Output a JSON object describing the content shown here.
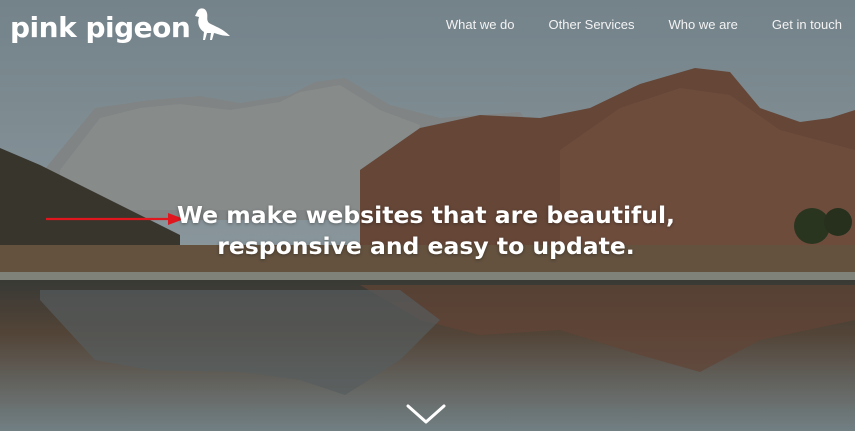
{
  "brand": {
    "name": "pink pigeon",
    "icon": "pigeon-icon"
  },
  "nav": {
    "items": [
      {
        "label": "What we do"
      },
      {
        "label": "Other Services"
      },
      {
        "label": "Who we are"
      },
      {
        "label": "Get in touch"
      }
    ]
  },
  "hero": {
    "headline_line1": "We make websites that are beautiful,",
    "headline_line2": "responsive and easy to update.",
    "annotation_icon": "red-arrow-icon",
    "scroll_icon": "chevron-down-icon"
  },
  "colors": {
    "text": "#ffffff",
    "annotation": "#e0161e",
    "sky": "#8e9ca3",
    "water": "#4a4a4a"
  }
}
